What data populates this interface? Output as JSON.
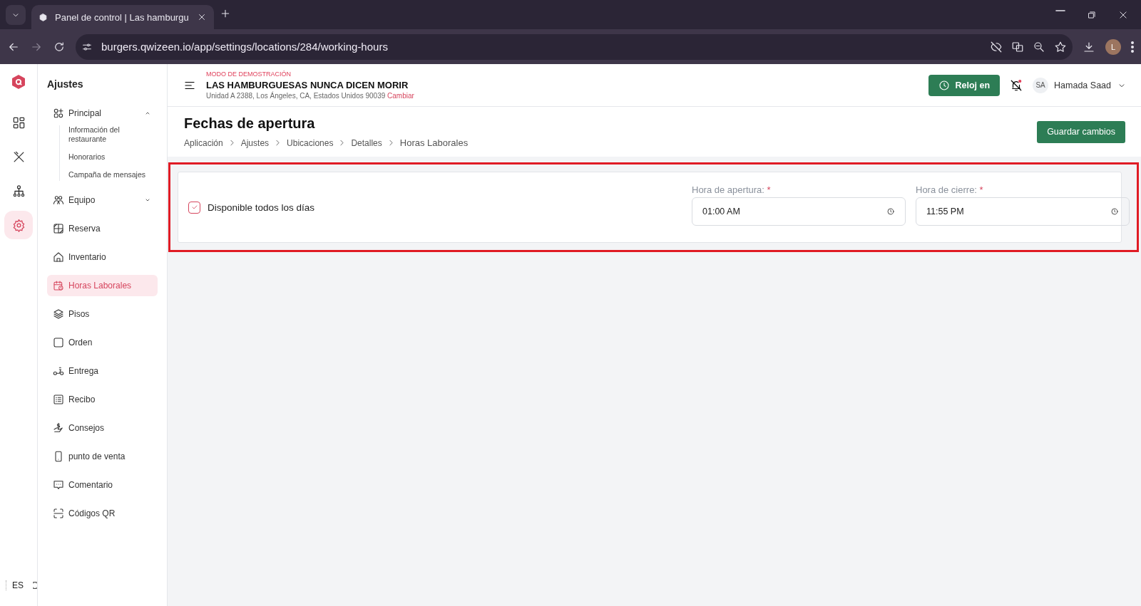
{
  "browser": {
    "tab_title": "Panel de control | Las hamburgu",
    "url": "burgers.qwizeen.io/app/settings/locations/284/working-hours",
    "profile_initial": "L"
  },
  "rail": [
    {
      "selected": false
    },
    {
      "selected": false
    },
    {
      "selected": false
    },
    {
      "selected": true
    }
  ],
  "language": "ES",
  "sidebar": {
    "title": "Ajustes",
    "items": [
      {
        "kind": "group",
        "label": "Principal",
        "expanded": true,
        "selected": false,
        "children": [
          {
            "label": "Información del restaurante"
          },
          {
            "label": "Honorarios"
          },
          {
            "label": "Campaña de mensajes"
          }
        ]
      },
      {
        "kind": "group",
        "label": "Equipo",
        "expanded": false,
        "selected": false
      },
      {
        "kind": "link",
        "label": "Reserva",
        "selected": false
      },
      {
        "kind": "link",
        "label": "Inventario",
        "selected": false
      },
      {
        "kind": "link",
        "label": "Horas Laborales",
        "selected": true
      },
      {
        "kind": "link",
        "label": "Pisos",
        "selected": false
      },
      {
        "kind": "link",
        "label": "Orden",
        "selected": false
      },
      {
        "kind": "link",
        "label": "Entrega",
        "selected": false
      },
      {
        "kind": "link",
        "label": "Recibo",
        "selected": false
      },
      {
        "kind": "link",
        "label": "Consejos",
        "selected": false
      },
      {
        "kind": "link",
        "label": "punto de venta",
        "selected": false
      },
      {
        "kind": "link",
        "label": "Comentario",
        "selected": false
      },
      {
        "kind": "link",
        "label": "Códigos QR",
        "selected": false
      }
    ]
  },
  "header": {
    "demo_label": "MODO DE DEMOSTRACIÓN",
    "restaurant": "LAS HAMBURGUESAS NUNCA DICEN MORIR",
    "address": "Unidad A 2388, Los Ángeles, CA, Estados Unidos 90039",
    "change_link": "Cambiar",
    "clock_button": "Reloj en",
    "user_initials": "SA",
    "user_name": "Hamada Saad"
  },
  "page": {
    "title": "Fechas de apertura",
    "breadcrumbs": [
      "Aplicación",
      "Ajustes",
      "Ubicaciones",
      "Detalles",
      "Horas Laborales"
    ],
    "save_button": "Guardar cambios"
  },
  "form": {
    "checkbox": {
      "label": "Disponible todos los días",
      "checked": true
    },
    "fields": [
      {
        "label": "Hora de apertura:",
        "required_mark": "*",
        "value": "01:00 AM"
      },
      {
        "label": "Hora de cierre:",
        "required_mark": "*",
        "value": "11:55 PM"
      }
    ]
  }
}
